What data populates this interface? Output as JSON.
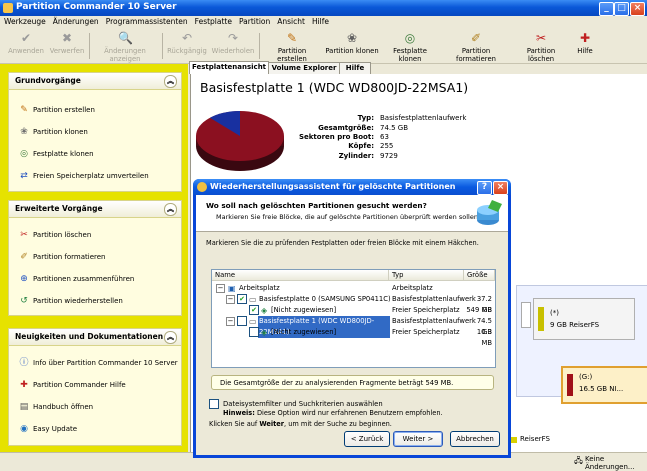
{
  "window": {
    "title": "Partition Commander 10 Server",
    "controls": {
      "minimize": "_",
      "maximize": "□",
      "close": "×"
    }
  },
  "menu": [
    "Werkzeuge",
    "Änderungen",
    "Programmassistenten",
    "Festplatte",
    "Partition",
    "Ansicht",
    "Hilfe"
  ],
  "toolbar": {
    "apply": "Anwenden",
    "discard": "Verwerfen",
    "show_changes": "Änderungen anzeigen",
    "undo": "Rückgängig",
    "redo": "Wiederholen",
    "create_partition": "Partition erstellen",
    "clone_partition": "Partition klonen",
    "clone_disk": "Festplatte klonen",
    "format_partition": "Partition formatieren",
    "delete_partition": "Partition löschen",
    "help": "Hilfe"
  },
  "sidebar": {
    "basic": {
      "title": "Grundvorgänge",
      "items": [
        "Partition erstellen",
        "Partition klonen",
        "Festplatte klonen",
        "Freien Speicherplatz umverteilen"
      ]
    },
    "advanced": {
      "title": "Erweiterte Vorgänge",
      "items": [
        "Partition löschen",
        "Partition formatieren",
        "Partitionen zusammenführen",
        "Partition wiederherstellen"
      ]
    },
    "news": {
      "title": "Neuigkeiten und Dokumentationen",
      "items": [
        "Info über Partition Commander 10 Server",
        "Partition Commander Hilfe",
        "Handbuch öffnen",
        "Easy Update"
      ]
    }
  },
  "tabs": [
    "Festplattenansicht",
    "Volume Explorer",
    "Hilfe"
  ],
  "disk": {
    "title": "Basisfestplatte 1 (WDC WD800JD-22MSA1)",
    "props": [
      {
        "label": "Typ:",
        "value": "Basisfestplattenlaufwerk"
      },
      {
        "label": "Gesamtgröße:",
        "value": "74.5 GB"
      },
      {
        "label": "Sektoren pro Boot:",
        "value": "63"
      },
      {
        "label": "Köpfe:",
        "value": "255"
      },
      {
        "label": "Zylinder:",
        "value": "9729"
      }
    ],
    "pie": {
      "used_fraction": 0.88,
      "colors": [
        "#8b1020",
        "#1830a0"
      ]
    }
  },
  "diskmap": {
    "part1_name": "(*)",
    "part1_detail": "9 GB ReiserFS",
    "part2_name": "(G:)",
    "part2_detail": "16.5 GB NI...",
    "legend": "ReiserFS"
  },
  "dialog": {
    "title": "Wiederherstellungsassistent für gelöschte Partitionen",
    "question": "Wo soll nach gelöschten Partitionen gesucht werden?",
    "subtext": "Markieren Sie freie Blöcke, die auf gelöschte Partitionen überprüft werden sollen.",
    "instruction": "Markieren Sie die zu prüfenden Festplatten oder freien Blöcke mit einem Häkchen.",
    "columns": [
      "Name",
      "Typ",
      "Größe"
    ],
    "rows": [
      {
        "name": "Arbeitsplatz",
        "type": "Arbeitsplatz",
        "size": ""
      },
      {
        "name": "Basisfestplatte 0 (SAMSUNG SP0411C)",
        "type": "Basisfestplattenlaufwerk",
        "size": "37.2 GB"
      },
      {
        "name": "[Nicht zugewiesen]",
        "type": "Freier Speicherplatz",
        "size": "549 MB"
      },
      {
        "name": "Basisfestplatte 1 (WDC WD800JD-22MSA1)",
        "type": "Basisfestplattenlaufwerk",
        "size": "74.5 GB"
      },
      {
        "name": "[Nicht zugewiesen]",
        "type": "Freier Speicherplatz",
        "size": "10.3 MB"
      }
    ],
    "total": "Die Gesamtgröße der zu analysierenden Fragmente beträgt 549 MB.",
    "fs_option": "Dateisystemfilter und Suchkriterien auswählen",
    "hint_label": "Hinweis:",
    "hint_text": "Diese Option wird nur erfahrenen Benutzern empfohlen.",
    "footer_prefix": "Klicken Sie auf",
    "footer_bold": "Weiter",
    "footer_suffix": ", um mit der Suche zu beginnen.",
    "back": "< Zurück",
    "next": "Weiter >",
    "cancel": "Abbrechen",
    "help_btn": "?",
    "close_btn": "×"
  },
  "status": {
    "text": "Keine Änderungen..."
  }
}
